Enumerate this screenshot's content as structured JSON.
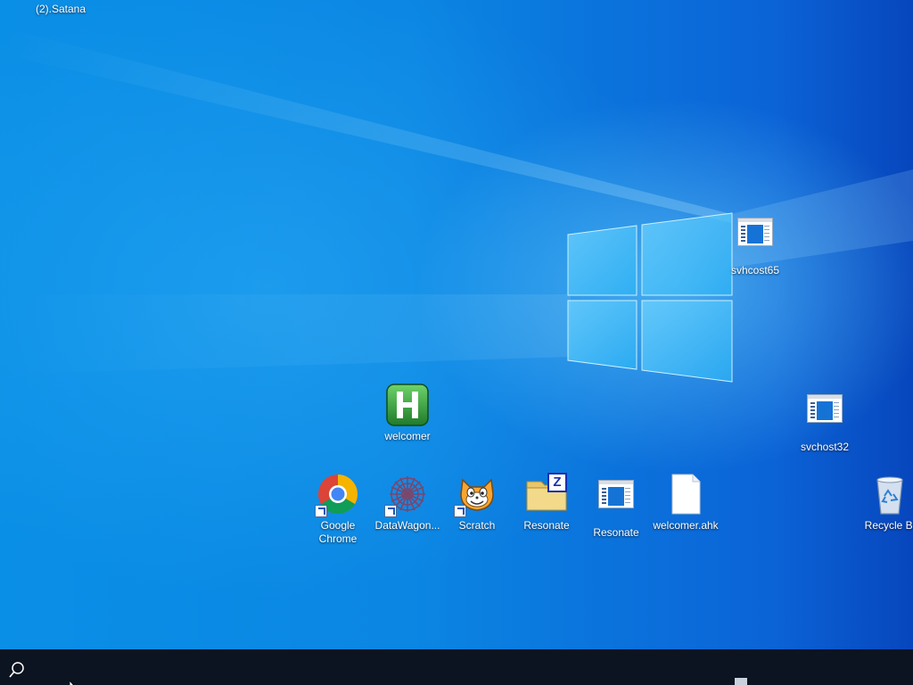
{
  "desktop": {
    "top_label": "(2).Satana",
    "icons": {
      "svchost65": {
        "label": "svhcost65",
        "icon": "executable-window-icon"
      },
      "svchost32": {
        "label": "svchost32",
        "icon": "executable-window-icon"
      },
      "welcomer": {
        "label": "welcomer",
        "icon": "autohotkey-h-icon"
      },
      "chrome": {
        "label_line1": "Google",
        "label_line2": "Chrome",
        "icon": "chrome-icon"
      },
      "datawagon": {
        "label": "DataWagon...",
        "icon": "datawagon-icon"
      },
      "scratch": {
        "label": "Scratch",
        "icon": "scratch-cat-icon"
      },
      "resonate_folder": {
        "label": "Resonate",
        "icon": "zip-folder-icon",
        "badge": "Z"
      },
      "resonate_exe": {
        "label": "Resonate",
        "icon": "executable-window-icon"
      },
      "welcomer_ahk": {
        "label": "welcomer.ahk",
        "icon": "text-file-icon"
      },
      "recycle_bin": {
        "label": "Recycle Bi",
        "icon": "recycle-bin-icon"
      }
    }
  },
  "taskbar": {
    "search_icon": "search-icon"
  },
  "colors": {
    "desktop_blue": "#0b86e3",
    "taskbar": "#0b1420",
    "chrome_red": "#db4437",
    "chrome_yellow": "#f4b400",
    "chrome_green": "#0f9d58",
    "chrome_blue": "#4285f4",
    "ahk_green": "#2e9a3a"
  }
}
